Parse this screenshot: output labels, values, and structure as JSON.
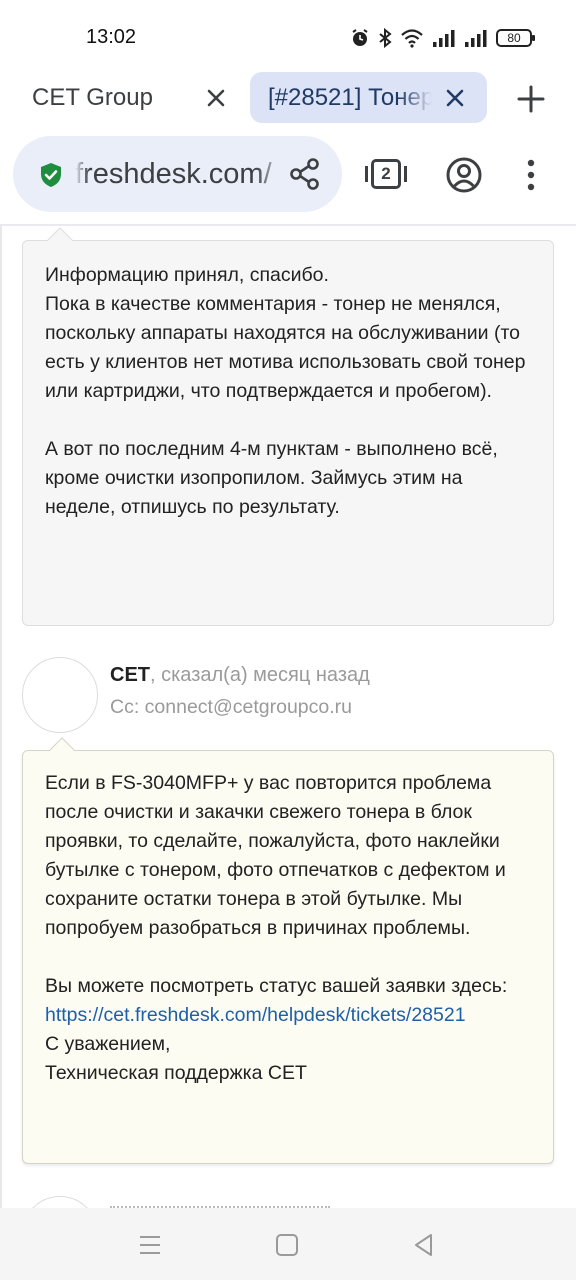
{
  "status_bar": {
    "time": "13:02",
    "battery": "80",
    "icons": [
      "alarm-icon",
      "bluetooth-icon",
      "wifi-icon",
      "signal-icon",
      "signal-icon",
      "battery-icon"
    ]
  },
  "tabs": [
    {
      "title": "CET Group",
      "active": false
    },
    {
      "title": "[#28521] Тонер",
      "active": true
    }
  ],
  "toolbar": {
    "url": "freshdesk.com/",
    "tab_count": "2",
    "secure_color": "#1e8e3e"
  },
  "messages": [
    {
      "body": "Информацию принял, спасибо.\nПока в качестве комментария - тонер не менялся, поскольку аппараты находятся на обслуживании (то есть у клиентов нет мотива использовать свой тонер или картриджи, что подтверждается и пробегом).\n\nА вот по последним 4-м пунктам - выполнено всё, кроме очистки изопропилом. Займусь этим на неделе, отпишусь по результату."
    },
    {
      "author": "CET",
      "meta": ", сказал(а) месяц назад",
      "cc": "Cc: connect@cetgroupco.ru",
      "body": "Если в FS-3040MFP+ у вас повторится проблема после очистки и закачки свежего тонера в блок проявки, то сделайте, пожалуйста, фото наклейки бутылке с тонером, фото отпечатков с дефектом и сохраните остатки тонера в этой бутылке. Мы попробуем разобраться в причинах проблемы.\n\nВы можете посмотреть статус вашей заявки здесь:",
      "link": "https://cet.freshdesk.com/helpdesk/tickets/28521",
      "signature": "С уважением,\nТехническая поддержка CET"
    }
  ],
  "colors": {
    "link": "#1f5fa8",
    "active_tab_bg": "#dde3f6",
    "omnibox_bg": "#e9eef8",
    "reply_bg": "#fcfcf3"
  }
}
